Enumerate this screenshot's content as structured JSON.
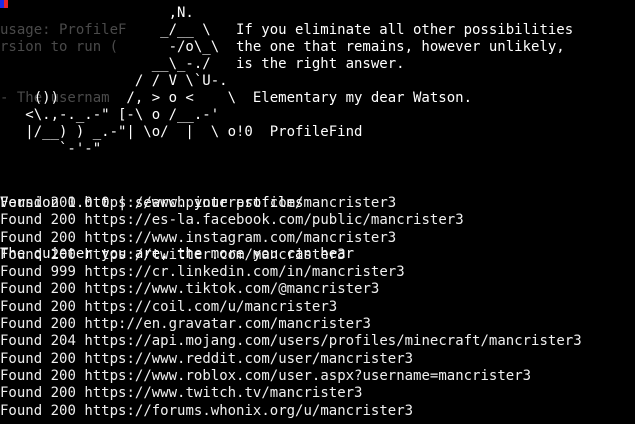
{
  "window": {
    "cursor_colors": [
      "#1a2be8",
      "#e8222a"
    ]
  },
  "banner": {
    "ascii_art": "                    ,N.\n                   _/__ \\   If you eliminate all other possibilities\n                    -/o\\_\\  the one that remains, however unlikely,\n                  __\\_-./   is the right answer.\n                / / V \\`U-.\n    ())        /, > o <    \\  Elementary my dear Watson.\n   <\\.,-._.-\" [-\\ o /__.-'\n   |/__) ) _.-\"| \\o/  |  \\ o!0  ProfileFind\n       `-'-\"",
    "ghost_text": "usage: ProfileF\nrsion to run (\n\n\n- The usernam\n"
  },
  "info": {
    "version_line": "Version 1.0.0 | search your profiles",
    "tagline": "The quieter you are, the more you can hear"
  },
  "results": [
    {
      "status": "Found",
      "code": "200",
      "url": "https://www.pinterest.com/mancrister3"
    },
    {
      "status": "Found",
      "code": "200",
      "url": "https://es-la.facebook.com/public/mancrister3"
    },
    {
      "status": "Found",
      "code": "200",
      "url": "https://www.instagram.com/mancrister3"
    },
    {
      "status": "Found",
      "code": "200",
      "url": "https://twitter.com/mancrister3"
    },
    {
      "status": "Found",
      "code": "999",
      "url": "https://cr.linkedin.com/in/mancrister3"
    },
    {
      "status": "Found",
      "code": "200",
      "url": "https://www.tiktok.com/@mancrister3"
    },
    {
      "status": "Found",
      "code": "200",
      "url": "https://coil.com/u/mancrister3"
    },
    {
      "status": "Found",
      "code": "200",
      "url": "http://en.gravatar.com/mancrister3"
    },
    {
      "status": "Found",
      "code": "204",
      "url": "https://api.mojang.com/users/profiles/minecraft/mancrister3"
    },
    {
      "status": "Found",
      "code": "200",
      "url": "https://www.reddit.com/user/mancrister3"
    },
    {
      "status": "Found",
      "code": "200",
      "url": "https://www.roblox.com/user.aspx?username=mancrister3"
    },
    {
      "status": "Found",
      "code": "200",
      "url": "https://www.twitch.tv/mancrister3"
    },
    {
      "status": "Found",
      "code": "200",
      "url": "https://forums.whonix.org/u/mancrister3"
    }
  ]
}
